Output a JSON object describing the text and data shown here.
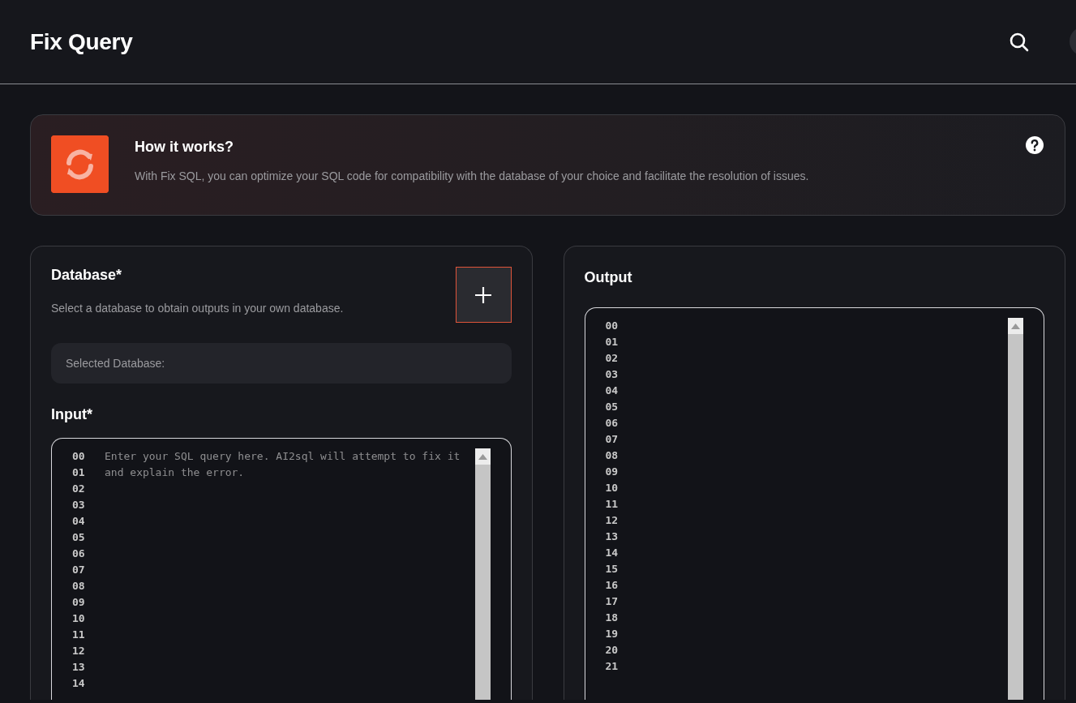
{
  "header": {
    "title": "Fix Query"
  },
  "info": {
    "title": "How it works?",
    "text": "With Fix SQL, you can optimize your SQL code for compatibility with the database of your choice and facilitate the resolution of issues."
  },
  "database": {
    "label": "Database*",
    "hint": "Select a database to obtain outputs in your own database.",
    "selected_label": "Selected Database:"
  },
  "input": {
    "label": "Input*",
    "placeholder": "Enter your SQL query here. AI2sql will attempt to fix it and explain the error.",
    "line_numbers": [
      "00",
      "01",
      "02",
      "03",
      "04",
      "05",
      "06",
      "07",
      "08",
      "09",
      "10",
      "11",
      "12",
      "13",
      "14"
    ]
  },
  "output": {
    "label": "Output",
    "line_numbers": [
      "00",
      "01",
      "02",
      "03",
      "04",
      "05",
      "06",
      "07",
      "08",
      "09",
      "10",
      "11",
      "12",
      "13",
      "14",
      "15",
      "16",
      "17",
      "18",
      "19",
      "20",
      "21"
    ]
  }
}
